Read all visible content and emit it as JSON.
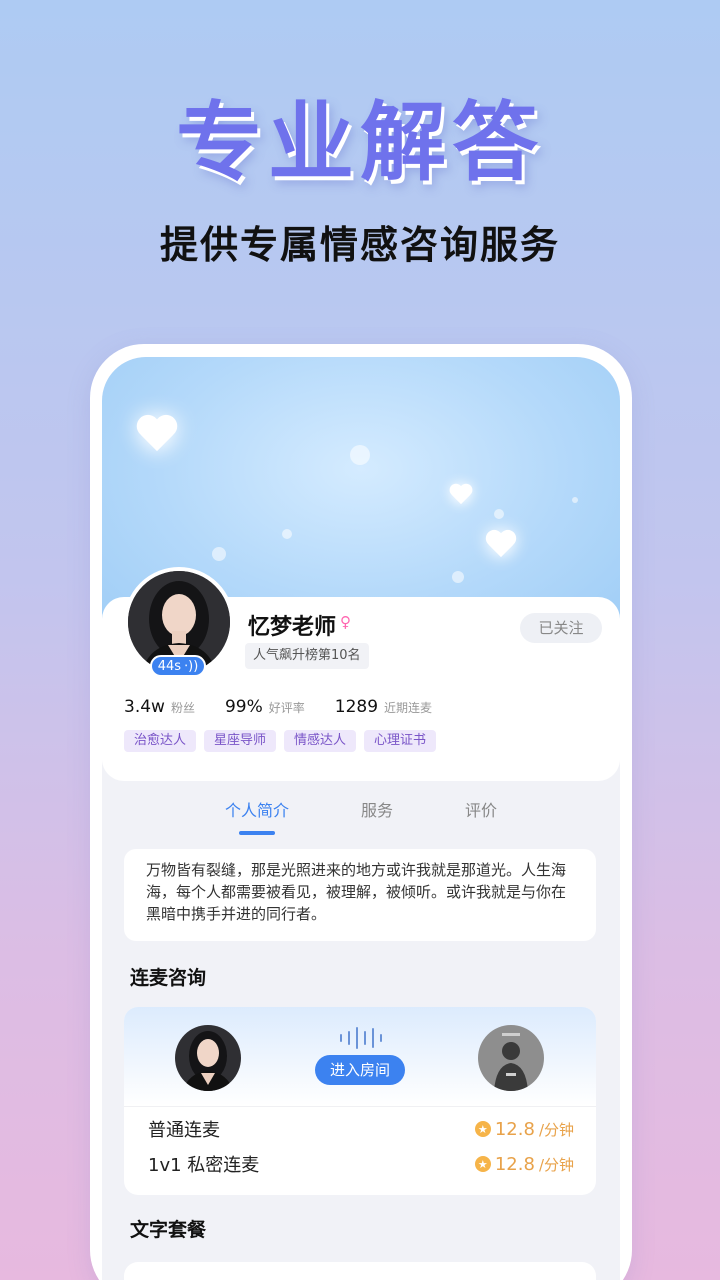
{
  "promo": {
    "title": "专业解答",
    "subtitle": "提供专属情感咨询服务"
  },
  "profile": {
    "name": "忆梦老师",
    "gender_icon": "female-icon",
    "rank": "人气飙升榜第10名",
    "voice_duration": "44s",
    "follow_label": "已关注",
    "stats": [
      {
        "value": "3.4w",
        "label": "粉丝"
      },
      {
        "value": "99%",
        "label": "好评率"
      },
      {
        "value": "1289",
        "label": "近期连麦"
      }
    ],
    "tags": [
      "治愈达人",
      "星座导师",
      "情感达人",
      "心理证书"
    ]
  },
  "tabs": [
    "个人简介",
    "服务",
    "评价"
  ],
  "active_tab": "个人简介",
  "bio": "万物皆有裂缝，那是光照进来的地方或许我就是那道光。人生海海，每个人都需要被看见，被理解，被倾听。或许我就是与你在黑暗中携手并进的同行者。",
  "call_section": {
    "title": "连麦咨询",
    "enter_label": "进入房间",
    "options": [
      {
        "name": "普通连麦",
        "price": "12.8",
        "unit": "/分钟"
      },
      {
        "name": "1v1 私密连麦",
        "price": "12.8",
        "unit": "/分钟"
      }
    ]
  },
  "text_section": {
    "title": "文字套餐"
  },
  "colors": {
    "accent": "#3c82f0",
    "title_purple": "#6f72ec",
    "tag_text": "#7a55c8",
    "price": "#e8a24a"
  }
}
